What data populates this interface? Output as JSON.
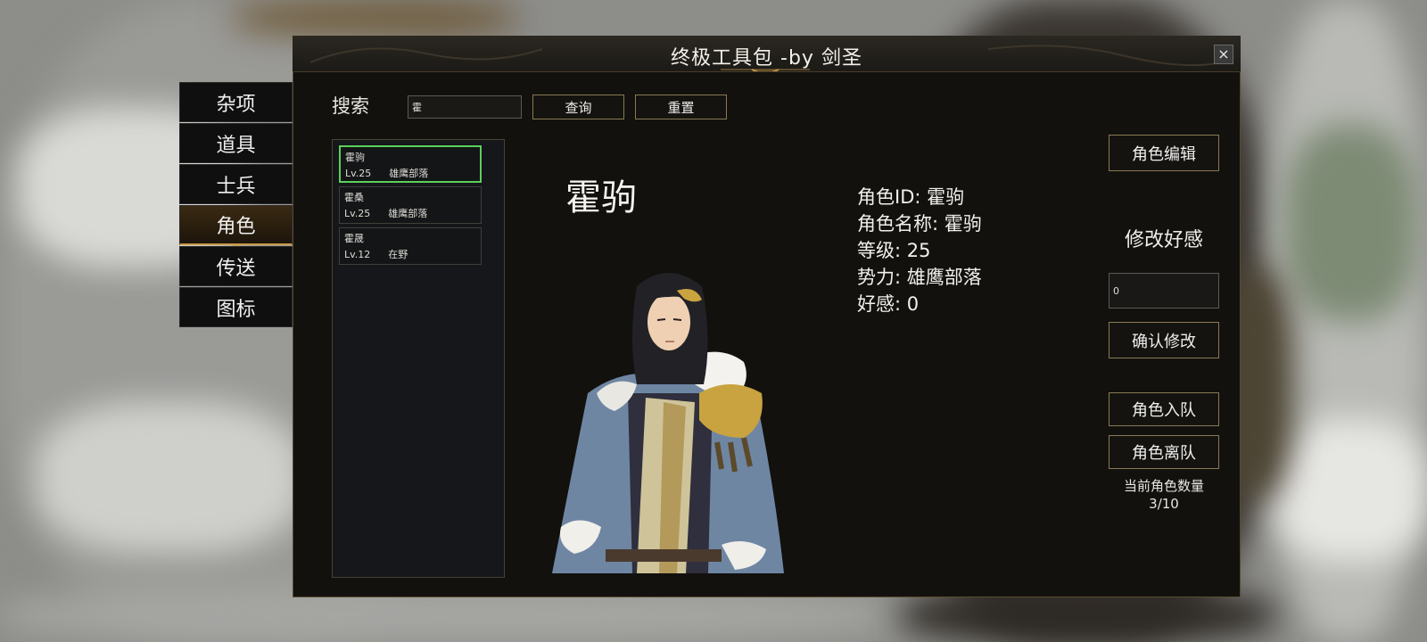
{
  "window": {
    "title": "终极工具包 -by 剑圣",
    "close_glyph": "×"
  },
  "sidebar": {
    "items": [
      {
        "label": "杂项",
        "active": false
      },
      {
        "label": "道具",
        "active": false
      },
      {
        "label": "士兵",
        "active": false
      },
      {
        "label": "角色",
        "active": true
      },
      {
        "label": "传送",
        "active": false
      },
      {
        "label": "图标",
        "active": false
      }
    ]
  },
  "search": {
    "label": "搜索",
    "value": "霍",
    "query_button": "查询",
    "reset_button": "重置"
  },
  "results": [
    {
      "name": "霍驹",
      "level": "Lv.25",
      "faction": "雄鹰部落",
      "selected": true
    },
    {
      "name": "霍桑",
      "level": "Lv.25",
      "faction": "雄鹰部落",
      "selected": false
    },
    {
      "name": "霍晟",
      "level": "Lv.12",
      "faction": "在野",
      "selected": false
    }
  ],
  "character": {
    "display_name": "霍驹",
    "id_line": "角色ID: 霍驹",
    "name_line": "角色名称: 霍驹",
    "level_line": "等级: 25",
    "faction_line": "势力: 雄鹰部落",
    "affection_line": "好感: 0"
  },
  "actions": {
    "edit_button": "角色编辑",
    "affection_title": "修改好感",
    "affection_value": "0",
    "confirm_button": "确认修改",
    "join_button": "角色入队",
    "leave_button": "角色离队",
    "count_label": "当前角色数量",
    "count_value": "3/10"
  },
  "colors": {
    "accent_gold": "#c99a4a",
    "selected_green": "#5bd05b",
    "panel_bg": "#12110e"
  }
}
